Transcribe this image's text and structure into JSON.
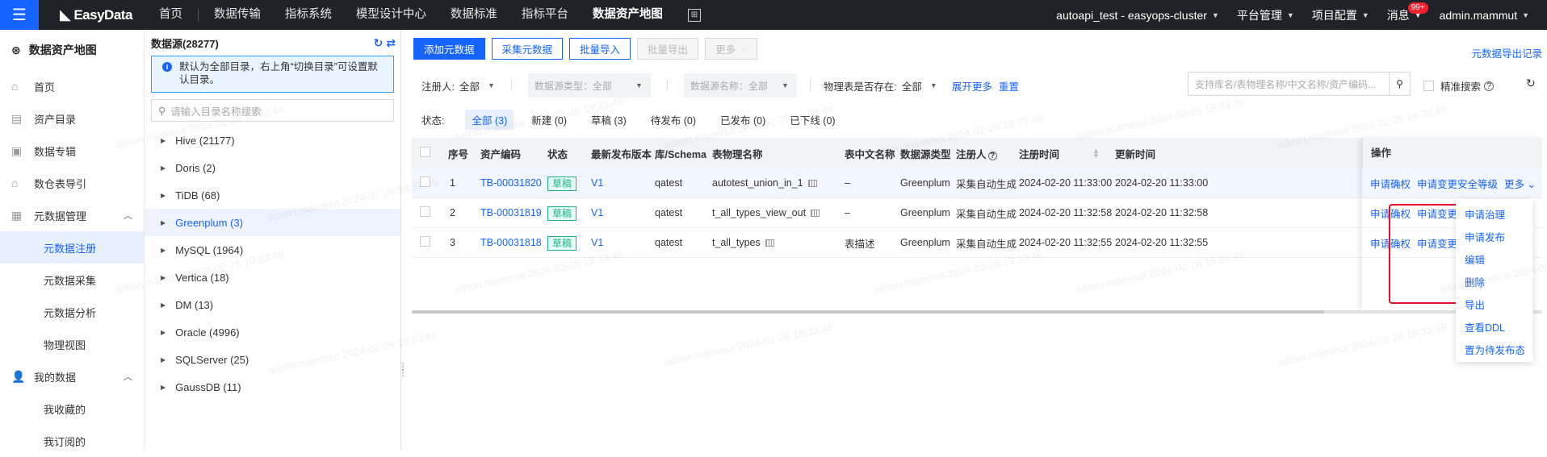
{
  "topbar": {
    "logo": "EasyData",
    "nav": [
      "首页",
      "数据传输",
      "指标系统",
      "模型设计中心",
      "数据标准",
      "指标平台",
      "数据资产地图"
    ],
    "active_index": 6,
    "cluster": "autoapi_test - easyops-cluster",
    "platform": "平台管理",
    "project": "项目配置",
    "messages": "消息",
    "message_badge": "99+",
    "user": "admin.mammut"
  },
  "leftnav": {
    "title": "数据资产地图",
    "items": [
      {
        "label": "首页",
        "icon": "home-icon"
      },
      {
        "label": "资产目录",
        "icon": "catalog-icon"
      },
      {
        "label": "数据专辑",
        "icon": "album-icon"
      },
      {
        "label": "数仓表导引",
        "icon": "warehouse-icon"
      },
      {
        "label": "元数据管理",
        "icon": "grid-icon"
      },
      {
        "label": "元数据注册",
        "sub": true,
        "active": true
      },
      {
        "label": "元数据采集",
        "sub": true
      },
      {
        "label": "元数据分析",
        "sub": true
      },
      {
        "label": "物理视图",
        "sub": true
      },
      {
        "label": "我的数据",
        "icon": "user-icon"
      },
      {
        "label": "我收藏的",
        "sub": true
      },
      {
        "label": "我订阅的",
        "sub": true
      }
    ]
  },
  "tree": {
    "title": "数据源(28277)",
    "tip": "默认为全部目录，右上角“切换目录”可设置默认目录。",
    "search_placeholder": "请输入目录名称搜索",
    "nodes": [
      "Hive (21177)",
      "Doris (2)",
      "TiDB (68)",
      "Greenplum (3)",
      "MySQL (1964)",
      "Vertica (18)",
      "DM (13)",
      "Oracle (4996)",
      "SQLServer (25)",
      "GaussDB (11)"
    ],
    "active_index": 3
  },
  "toolbar": {
    "add": "添加元数据",
    "collect": "采集元数据",
    "import": "批量导入",
    "export": "批量导出",
    "more": "更多",
    "export_record": "元数据导出记录"
  },
  "filters": {
    "registrant_label": "注册人:",
    "registrant_value": "全部",
    "ds_type_placeholder": "数据源类型：全部",
    "ds_name_placeholder": "数据源名称：全部",
    "physical_label": "物理表是否存在:",
    "physical_value": "全部",
    "expand": "展开更多",
    "reset": "重置",
    "search_placeholder": "支持库名/表物理名称/中文名称/资产编码...",
    "precise": "精准搜索"
  },
  "status": {
    "label": "状态:",
    "tabs": [
      "全部 (3)",
      "新建 (0)",
      "草稿 (3)",
      "待发布 (0)",
      "已发布 (0)",
      "已下线 (0)"
    ]
  },
  "table": {
    "headers": [
      "序号",
      "资产编码",
      "状态",
      "最新发布版本",
      "库/Schema",
      "表物理名称",
      "表中文名称",
      "数据源类型",
      "注册人",
      "注册时间",
      "更新时间",
      "操作"
    ],
    "rows": [
      {
        "no": "1",
        "code": "TB-00031820",
        "status": "草稿",
        "version": "V1",
        "schema": "qatest",
        "name": "autotest_union_in_1",
        "cn": "–",
        "type": "Greenplum",
        "registrant": "采集自动生成",
        "reg_time": "2024-02-20 11:33:00",
        "upd_time": "2024-02-20 11:33:00",
        "op1": "申请确权",
        "op2": "申请变更安全等级",
        "op3": "更多"
      },
      {
        "no": "2",
        "code": "TB-00031819",
        "status": "草稿",
        "version": "V1",
        "schema": "qatest",
        "name": "t_all_types_view_out",
        "cn": "–",
        "type": "Greenplum",
        "registrant": "采集自动生成",
        "reg_time": "2024-02-20 11:32:58",
        "upd_time": "2024-02-20 11:32:58",
        "op1": "申请确权",
        "op2": "申请变更"
      },
      {
        "no": "3",
        "code": "TB-00031818",
        "status": "草稿",
        "version": "V1",
        "schema": "qatest",
        "name": "t_all_types",
        "cn": "表描述",
        "type": "Greenplum",
        "registrant": "采集自动生成",
        "reg_time": "2024-02-20 11:32:55",
        "upd_time": "2024-02-20 11:32:55",
        "op1": "申请确权",
        "op2": "申请变更"
      }
    ]
  },
  "dropdown": [
    "申请治理",
    "申请发布",
    "编辑",
    "删除",
    "导出",
    "查看DDL",
    "置为待发布态"
  ],
  "watermark": "admin.mammut 2024-02-26 19:33:46"
}
